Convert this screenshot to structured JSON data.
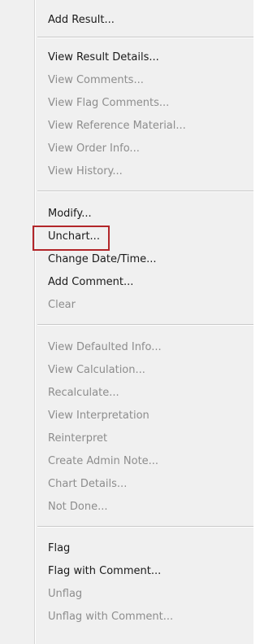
{
  "menu": {
    "groups": [
      {
        "items": [
          {
            "label": "Add Result...",
            "enabled": true
          }
        ]
      },
      {
        "items": [
          {
            "label": "View Result Details...",
            "enabled": true
          },
          {
            "label": "View Comments...",
            "enabled": false
          },
          {
            "label": "View Flag Comments...",
            "enabled": false
          },
          {
            "label": "View Reference Material...",
            "enabled": false
          },
          {
            "label": "View Order Info...",
            "enabled": false
          },
          {
            "label": "View History...",
            "enabled": false
          }
        ]
      },
      {
        "items": [
          {
            "label": "Modify...",
            "enabled": true
          },
          {
            "label": "Unchart...",
            "enabled": true,
            "highlighted": true
          },
          {
            "label": "Change Date/Time...",
            "enabled": true
          },
          {
            "label": "Add Comment...",
            "enabled": true
          },
          {
            "label": "Clear",
            "enabled": false
          }
        ]
      },
      {
        "items": [
          {
            "label": "View Defaulted Info...",
            "enabled": false
          },
          {
            "label": "View Calculation...",
            "enabled": false
          },
          {
            "label": "Recalculate...",
            "enabled": false
          },
          {
            "label": "View Interpretation",
            "enabled": false
          },
          {
            "label": "Reinterpret",
            "enabled": false
          },
          {
            "label": "Create Admin Note...",
            "enabled": false
          },
          {
            "label": "Chart Details...",
            "enabled": false
          },
          {
            "label": "Not Done...",
            "enabled": false
          }
        ]
      },
      {
        "items": [
          {
            "label": "Flag",
            "enabled": true
          },
          {
            "label": "Flag with Comment...",
            "enabled": true
          },
          {
            "label": "Unflag",
            "enabled": false
          },
          {
            "label": "Unflag with Comment...",
            "enabled": false
          }
        ]
      }
    ],
    "colors": {
      "enabled_text": "#1a1a1a",
      "disabled_text": "#8d8d8d",
      "highlight_border": "#b2262a",
      "background": "#f0f0f0"
    }
  }
}
